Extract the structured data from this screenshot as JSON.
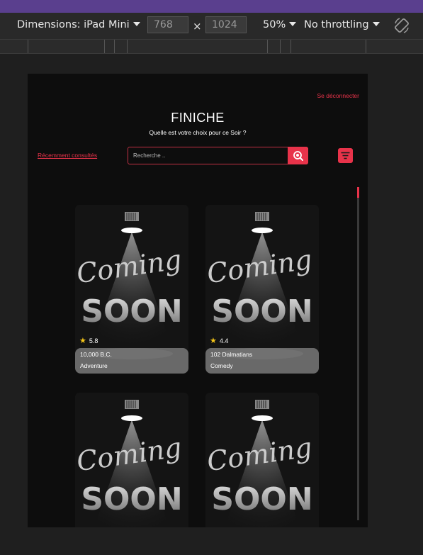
{
  "devtools": {
    "dimensions_label": "Dimensions: iPad Mini",
    "width": "768",
    "height": "1024",
    "times": "×",
    "zoom": "50%",
    "throttling": "No throttling"
  },
  "app": {
    "logout": "Se déconnecter",
    "title": "FINICHE",
    "subtitle": "Quelle est votre choix pour ce Soir ?",
    "recent": "Récemment consultés",
    "search_placeholder": "Recherche ..",
    "accent": "#e8334a"
  },
  "poster_text": {
    "line1": "Coming",
    "line2": "SOON"
  },
  "movies": [
    {
      "rating": "5.8",
      "title": "10,000 B.C.",
      "genre": "Adventure"
    },
    {
      "rating": "4.4",
      "title": "102 Dalmatians",
      "genre": "Comedy"
    }
  ]
}
